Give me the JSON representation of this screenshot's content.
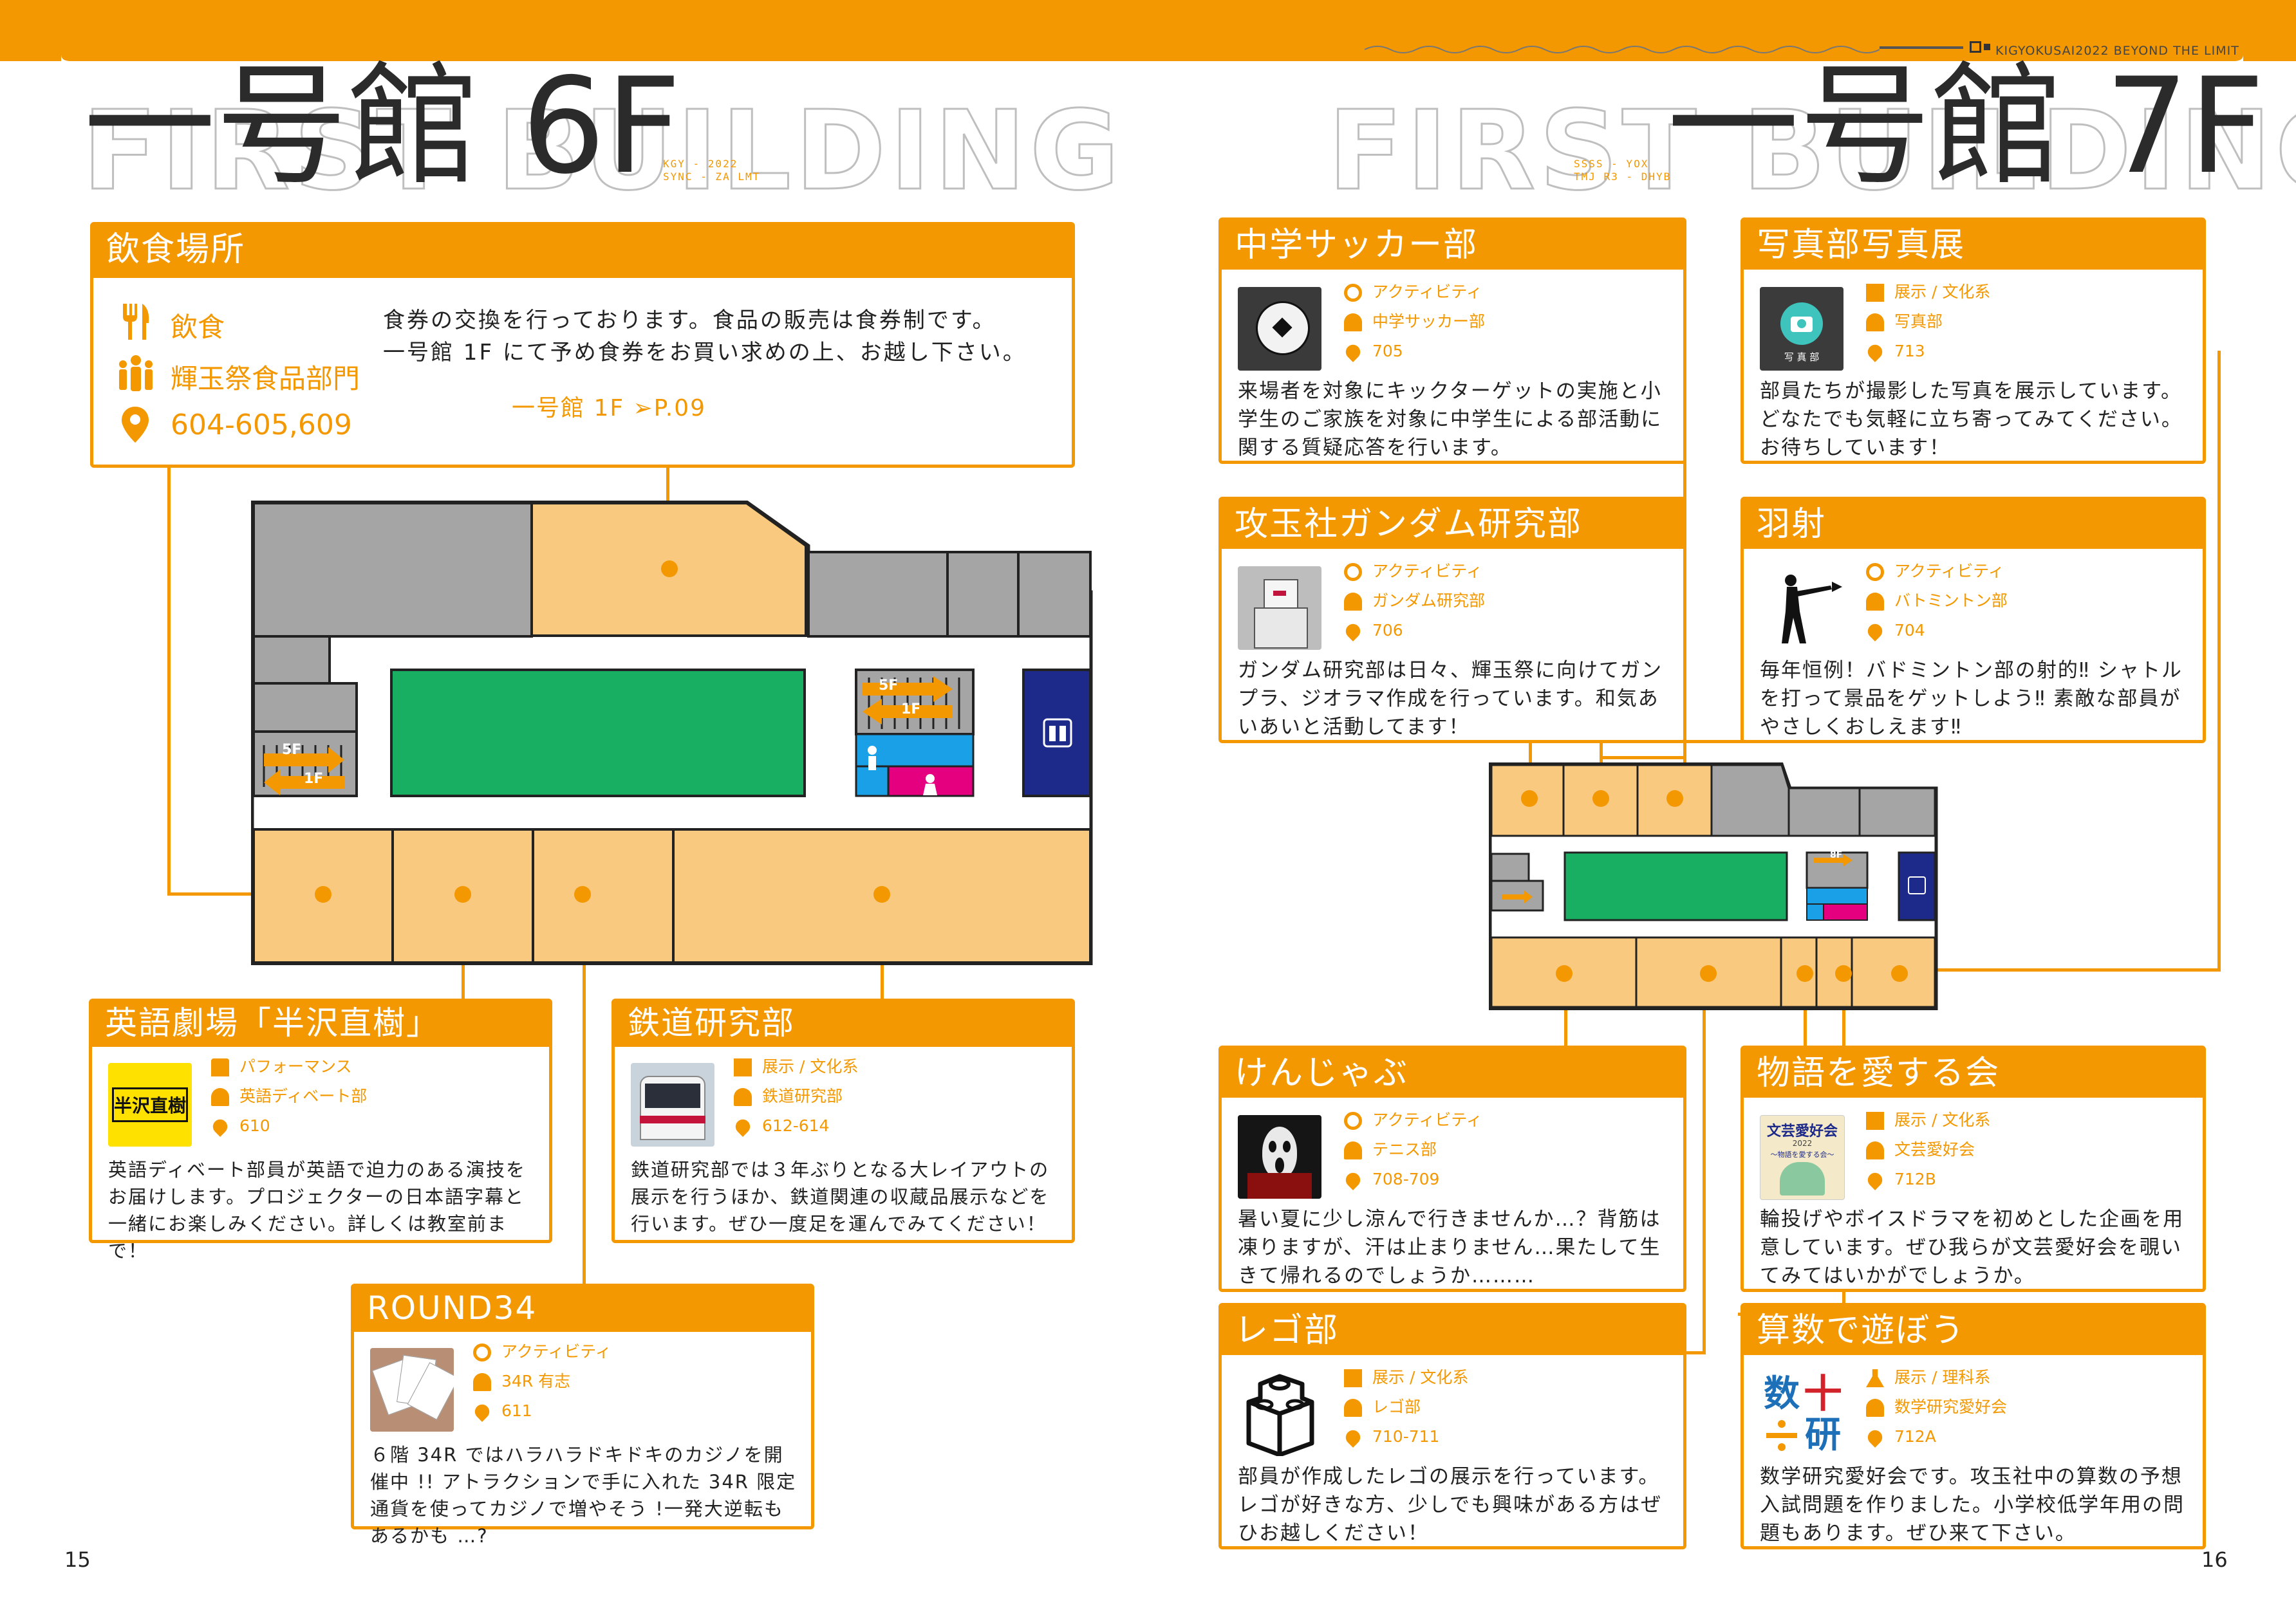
{
  "header": {
    "tagline": "KIGYOKUSAI2022 BEYOND THE LIMIT"
  },
  "left": {
    "bg_word": "FIRST BUILDING",
    "title": "一号館 6F",
    "code_1": "KGY - 2022",
    "code_2": "SYNC - ZA LMT",
    "food": {
      "title": "飲食場所",
      "category": "飲食",
      "org": "輝玉祭食品部門",
      "rooms": "604-605,609",
      "desc_1": "食券の交換を行っております。食品の販売は食券制です。",
      "desc_2": "一号館 1F にて予め食券をお買い求めの上、お越し下さい。",
      "ref": "一号館 1F ➢P.09"
    },
    "cards": [
      {
        "title": "英語劇場「半沢直樹」",
        "category": "パフォーマンス",
        "org": "英語ディベート部",
        "room": "610",
        "thumb_text": "半沢直樹",
        "desc": "英語ディベート部員が英語で迫力のある演技をお届けします。プロジェクターの日本語字幕と一緒にお楽しみください。詳しくは教室前まで！"
      },
      {
        "title": "鉄道研究部",
        "category": "展示 / 文化系",
        "org": "鉄道研究部",
        "room": "612-614",
        "desc": "鉄道研究部では３年ぶりとなる大レイアウトの展示を行うほか、鉄道関連の収蔵品展示などを行います。ぜひ一度足を運んでみてください！"
      },
      {
        "title": "ROUND34",
        "category": "アクティビティ",
        "org": "34R 有志",
        "room": "611",
        "desc": "６階 34R ではハラハラドキドキのカジノを開催中 !! アトラクションで手に入れた 34R 限定通貨を使ってカジノで増やそう !一発大逆転もあるかも …?"
      }
    ],
    "page_number": "15"
  },
  "right": {
    "bg_word": "FIRST BUILDING",
    "title": "一号館 7F",
    "code_1": "SSSS - YOX",
    "code_2": "TMJ R3 - DHYB",
    "cards": [
      {
        "title": "中学サッカー部",
        "category": "アクティビティ",
        "org": "中学サッカー部",
        "room": "705",
        "desc": "来場者を対象にキックターゲットの実施と小学生のご家族を対象に中学生による部活動に関する質疑応答を行います。"
      },
      {
        "title": "写真部写真展",
        "category": "展示 / 文化系",
        "org": "写真部",
        "room": "713",
        "thumb_text": "写 真 部",
        "desc": "部員たちが撮影した写真を展示しています。どなたでも気軽に立ち寄ってみてください。お待ちしています！"
      },
      {
        "title": "攻玉社ガンダム研究部",
        "category": "アクティビティ",
        "org": "ガンダム研究部",
        "room": "706",
        "desc": "ガンダム研究部は日々、輝玉祭に向けてガンプラ、ジオラマ作成を行っています。和気あいあいと活動してます！"
      },
      {
        "title": "羽射",
        "category": "アクティビティ",
        "org": "バトミントン部",
        "room": "704",
        "desc": "毎年恒例！バドミントン部の射的‼ シャトルを打って景品をゲットしよう‼ 素敵な部員がやさしくおしえます‼"
      },
      {
        "title": "けんじゃぶ",
        "category": "アクティビティ",
        "org": "テニス部",
        "room": "708-709",
        "desc": "暑い夏に少し涼んで行きませんか…？背筋は凍りますが、汗は止まりません…果たして生きて帰れるのでしょうか………"
      },
      {
        "title": "物語を愛する会",
        "category": "展示 / 文化系",
        "org": "文芸愛好会",
        "room": "712B",
        "thumb_text": "文芸愛好会",
        "thumb_sub1": "2022",
        "thumb_sub2": "〜物語を愛する会〜",
        "desc": "輪投げやボイスドラマを初めとした企画を用意しています。ぜひ我らが文芸愛好会を覗いてみてはいかがでしょうか。"
      },
      {
        "title": "レゴ部",
        "category": "展示 / 文化系",
        "org": "レゴ部",
        "room": "710-711",
        "desc": "部員が作成したレゴの展示を行っています。レゴが好きな方、少しでも興味がある方はぜひお越しください！"
      },
      {
        "title": "算数で遊ぼう",
        "category": "展示 / 理科系",
        "org": "数学研究愛好会",
        "room": "712A",
        "thumb_text_1": "数",
        "thumb_text_2": "十",
        "thumb_text_3": "研",
        "desc": "数学研究愛好会です。攻玉社中の算数の予想入試問題を作りました。小学校低学年用の問題もあります。ぜひ来て下さい。"
      }
    ],
    "page_number": "16"
  },
  "map": {
    "stair_up": "5F",
    "stair_down": "1F",
    "stair_up_small": "8F"
  },
  "colors": {
    "accent": "#f39800",
    "room": "#f8c97e",
    "gray": "#a5a5a5",
    "hall": "#18af62",
    "elevator": "#1d2a8a",
    "toilet_m": "#1aa0e6",
    "toilet_f": "#e4007f"
  }
}
